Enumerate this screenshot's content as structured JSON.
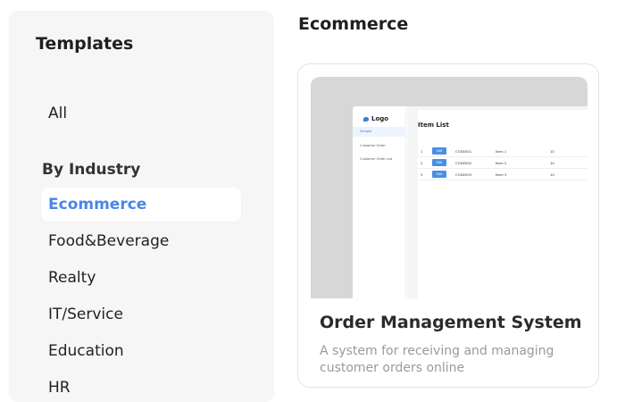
{
  "sidebar": {
    "title": "Templates",
    "all_label": "All",
    "section_label": "By Industry",
    "items": [
      {
        "label": "Ecommerce"
      },
      {
        "label": "Food&Beverage"
      },
      {
        "label": "Realty"
      },
      {
        "label": "IT/Service"
      },
      {
        "label": "Education"
      },
      {
        "label": "HR"
      }
    ],
    "active_index": 0
  },
  "main": {
    "title": "Ecommerce",
    "card": {
      "title": "Order Management System",
      "description": "A system for receiving and managing customer orders online",
      "preview": {
        "logo": "Logo",
        "menu": [
          "Sample",
          "Customer Order",
          "Customer Order List"
        ],
        "heading": "Item List",
        "rows": [
          {
            "num": "1",
            "button": "Edit",
            "code": "CODE001",
            "name": "Item 1",
            "qty": "10"
          },
          {
            "num": "2",
            "button": "Edit",
            "code": "CODE002",
            "name": "Item 2",
            "qty": "10"
          },
          {
            "num": "3",
            "button": "Edit",
            "code": "CODE003",
            "name": "Item 3",
            "qty": "10"
          }
        ]
      }
    }
  },
  "colors": {
    "accent": "#4a86e8",
    "sidebar_bg": "#f6f6f6",
    "preview_bg": "#d7d7d7",
    "description": "#9a9a9a"
  }
}
